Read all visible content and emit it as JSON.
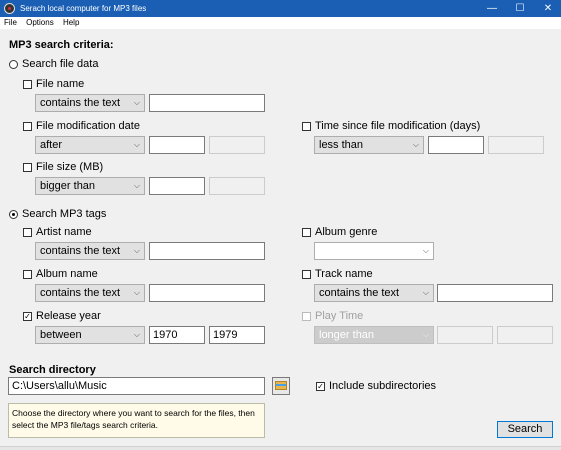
{
  "window": {
    "title": "Serach local computer for MP3 files",
    "minimize": "—",
    "maximize": "☐",
    "close": "✕"
  },
  "menu": [
    "File",
    "Options",
    "Help"
  ],
  "criteria_header": "MP3 search criteria:",
  "file_data": {
    "radio_label": "Search file data",
    "selected": false,
    "file_name": {
      "label": "File name",
      "checked": false,
      "operator": "contains the text",
      "value": ""
    },
    "mod_date": {
      "label": "File modification date",
      "checked": false,
      "operator": "after",
      "value": "",
      "value2": ""
    },
    "time_since": {
      "label": "Time since file modification (days)",
      "checked": false,
      "operator": "less than",
      "value": "",
      "value2": ""
    },
    "file_size": {
      "label": "File size (MB)",
      "checked": false,
      "operator": "bigger than",
      "value": "",
      "value2": ""
    }
  },
  "mp3_tags": {
    "radio_label": "Search MP3 tags",
    "selected": true,
    "artist": {
      "label": "Artist name",
      "checked": false,
      "operator": "contains the text",
      "value": ""
    },
    "genre": {
      "label": "Album genre",
      "checked": false,
      "value": ""
    },
    "album": {
      "label": "Album name",
      "checked": false,
      "operator": "contains the text",
      "value": ""
    },
    "track": {
      "label": "Track name",
      "checked": false,
      "operator": "contains the text",
      "value": ""
    },
    "release_year": {
      "label": "Release year",
      "checked": true,
      "operator": "between",
      "from": "1970",
      "to": "1979"
    },
    "play_time": {
      "label": "Play Time",
      "checked": false,
      "enabled": false,
      "operator": "longer than",
      "value": "",
      "value2": ""
    }
  },
  "directory": {
    "header": "Search directory",
    "path": "C:\\Users\\allu\\Music",
    "include_sub_label": "Include subdirectories",
    "include_sub": true,
    "hint_line1": "Choose the directory where you want to search for the files, then",
    "hint_line2": "select the MP3 file/tags  search criteria."
  },
  "search_button": "Search",
  "glyphs": {
    "check": "✓",
    "dropdown": "⌵"
  },
  "colors": {
    "titlebar": "#1a5fb4",
    "accent": "#0078d7",
    "hint_bg": "#fffbe8"
  }
}
